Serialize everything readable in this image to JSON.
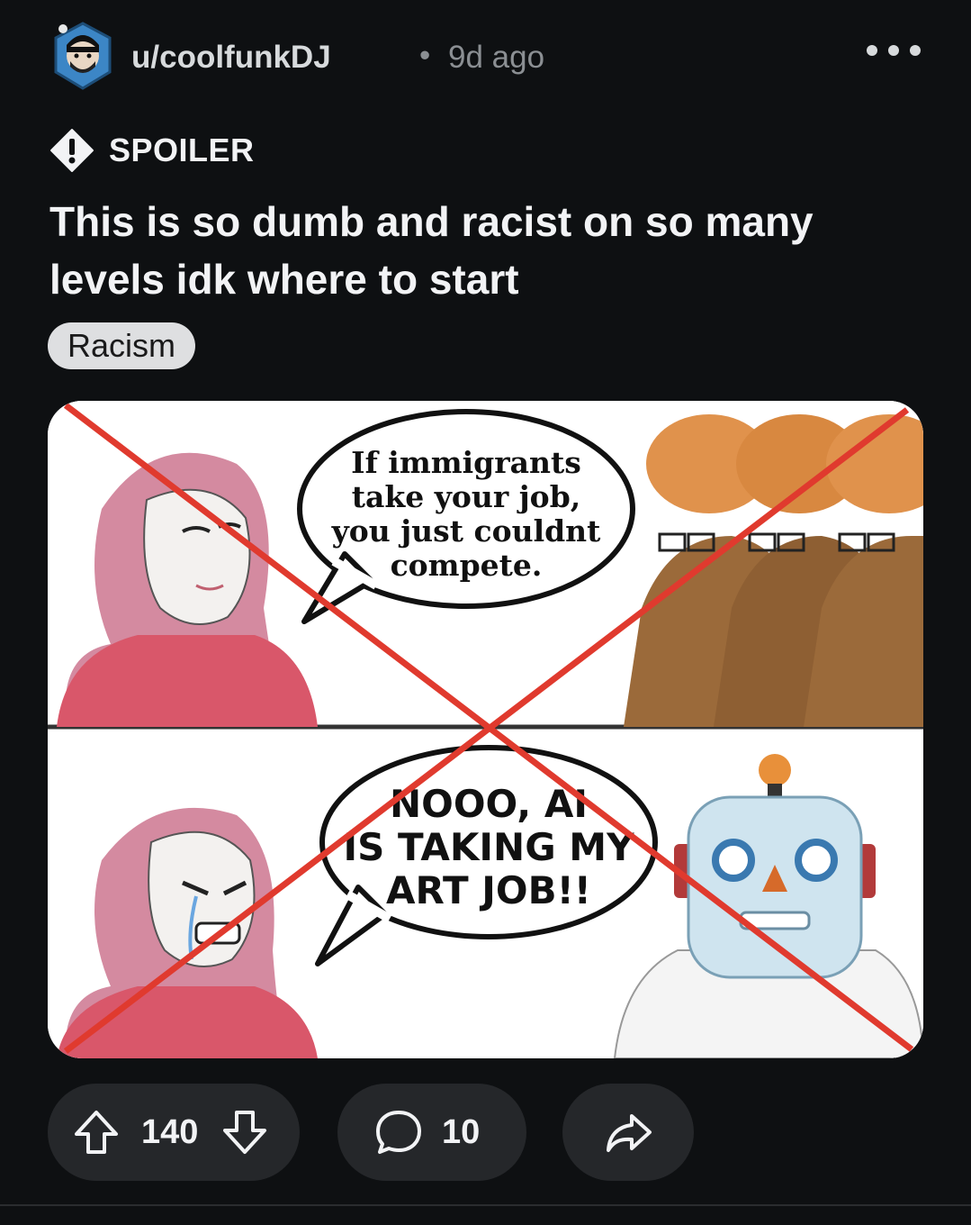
{
  "post": {
    "username": "u/coolfunkDJ",
    "separator": "•",
    "age": "9d ago",
    "spoiler_label": "SPOILER",
    "title": "This is so dumb and racist on so many levels idk where to start",
    "flair": "Racism"
  },
  "meme": {
    "top_bubble": [
      "If immigrants",
      "take your job,",
      "you just couldnt",
      "compete."
    ],
    "bottom_bubble": [
      "NOOO, AI",
      "IS TAKING MY",
      "ART JOB!!"
    ],
    "cross_color": "#e03a2e"
  },
  "actions": {
    "upvotes": "140",
    "comments": "10"
  },
  "icons": [
    "avatar",
    "more-icon",
    "spoiler-icon",
    "upvote-icon",
    "downvote-icon",
    "comment-icon",
    "share-icon"
  ],
  "colors": {
    "background": "#0e1012",
    "pill": "#25272a",
    "flair_bg": "#dedfe1"
  }
}
